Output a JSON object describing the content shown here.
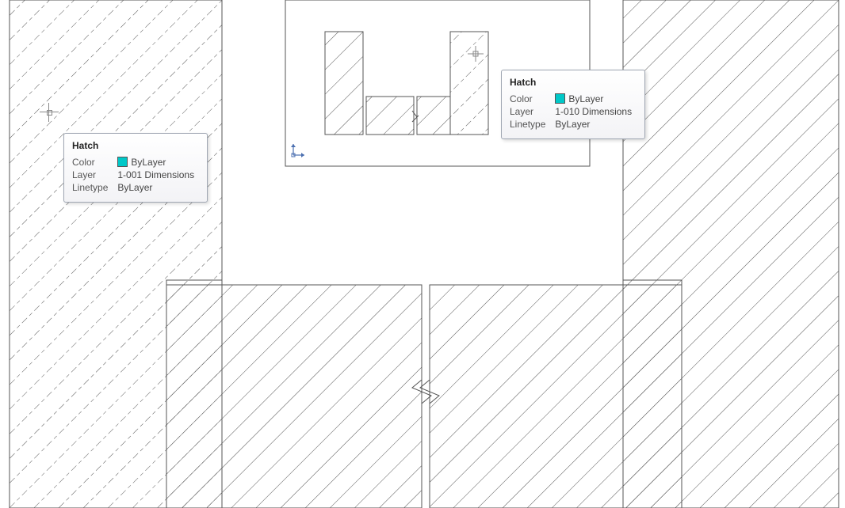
{
  "tooltip_left": {
    "title": "Hatch",
    "rows": {
      "color_label": "Color",
      "color_value": "ByLayer",
      "color_swatch": "#00c8c8",
      "layer_label": "Layer",
      "layer_value": "1-001 Dimensions",
      "linetype_label": "Linetype",
      "linetype_value": "ByLayer"
    }
  },
  "tooltip_right": {
    "title": "Hatch",
    "rows": {
      "color_label": "Color",
      "color_value": "ByLayer",
      "color_swatch": "#00c8c8",
      "layer_label": "Layer",
      "layer_value": "1-010 Dimensions",
      "linetype_label": "Linetype",
      "linetype_value": "ByLayer"
    }
  },
  "drawing": {
    "ucs_icon_label": "UCS",
    "colors": {
      "outline": "#555555",
      "hatch_solid": "#555555",
      "hatch_dashed": "#555555"
    }
  }
}
